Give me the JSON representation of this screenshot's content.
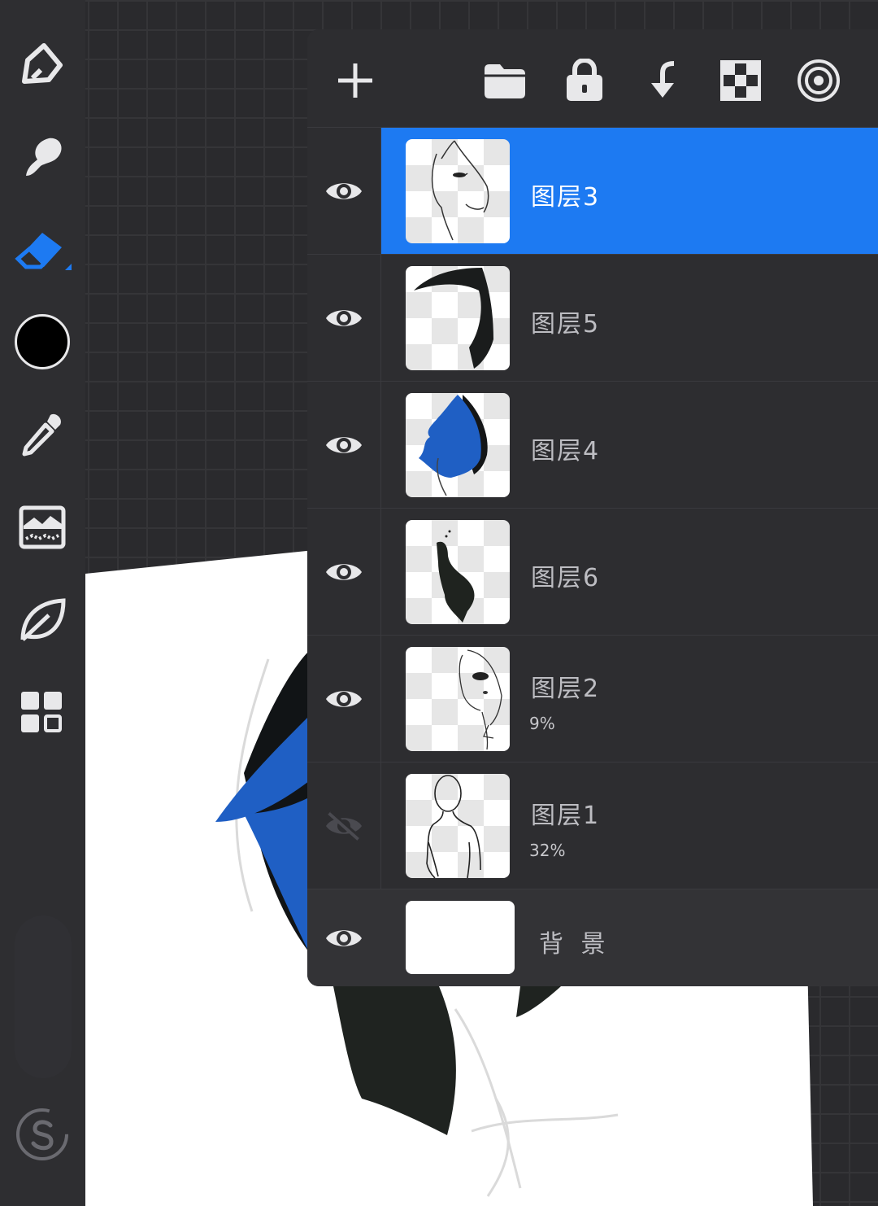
{
  "toolbar": {
    "tools": [
      {
        "name": "paint-brush-icon"
      },
      {
        "name": "smudge-icon"
      },
      {
        "name": "eraser-icon",
        "active": true
      },
      {
        "name": "color-swatch",
        "color": "#000000"
      },
      {
        "name": "eyedropper-icon"
      },
      {
        "name": "adjustments-icon"
      },
      {
        "name": "leaf-icon"
      },
      {
        "name": "gallery-grid-icon"
      }
    ],
    "active_color": "#1d7af2",
    "bottom_icon": "s-logo-icon"
  },
  "panel": {
    "header_icons": [
      "plus-icon",
      "folder-icon",
      "lock-icon",
      "merge-down-icon",
      "checker-icon",
      "target-icon"
    ],
    "layers": [
      {
        "name": "图层3",
        "opacity": "",
        "visible": true,
        "selected": true
      },
      {
        "name": "图层5",
        "opacity": "",
        "visible": true,
        "selected": false
      },
      {
        "name": "图层4",
        "opacity": "",
        "visible": true,
        "selected": false
      },
      {
        "name": "图层6",
        "opacity": "",
        "visible": true,
        "selected": false
      },
      {
        "name": "图层2",
        "opacity": "9%",
        "visible": true,
        "selected": false
      },
      {
        "name": "图层1",
        "opacity": "32%",
        "visible": false,
        "selected": false
      }
    ],
    "background": {
      "name": "背 景",
      "visible": true
    }
  },
  "colors": {
    "selection": "#1d7af2",
    "panel": "#2d2d30",
    "hair_blue": "#1f5fc4"
  }
}
